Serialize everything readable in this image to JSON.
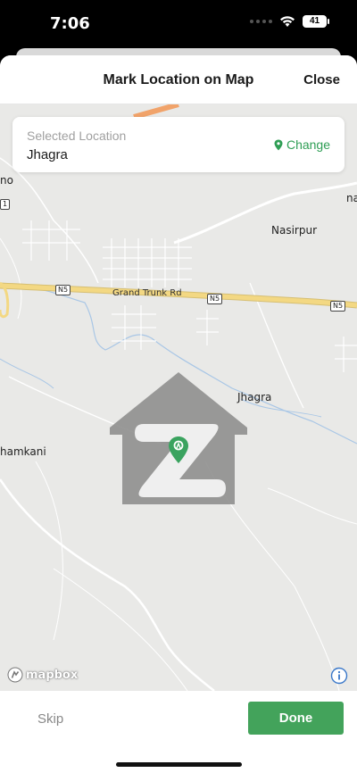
{
  "status_bar": {
    "time": "7:06",
    "battery": "41"
  },
  "header": {
    "title": "Mark Location on Map",
    "close_label": "Close"
  },
  "location_card": {
    "label": "Selected Location",
    "value": "Jhagra",
    "change_label": "Change",
    "change_icon": "map-pin-icon"
  },
  "map": {
    "labels": {
      "nasirpur": "Nasirpur",
      "jhagra": "Jhagra",
      "shamkani": "hamkani",
      "edge_left": "no",
      "edge_right": "na"
    },
    "road_name": "Grand Trunk Rd",
    "shields": [
      "N5",
      "N5",
      "N5",
      "1"
    ],
    "attribution": "mapbox",
    "colors": {
      "land": "#e9e9e7",
      "highway": "#f3d883",
      "motorway": "#f1a36a",
      "water": "#a8c6e6",
      "pin": "#3aa35f"
    }
  },
  "footer": {
    "skip_label": "Skip",
    "done_label": "Done",
    "done_color": "#43a35b"
  }
}
